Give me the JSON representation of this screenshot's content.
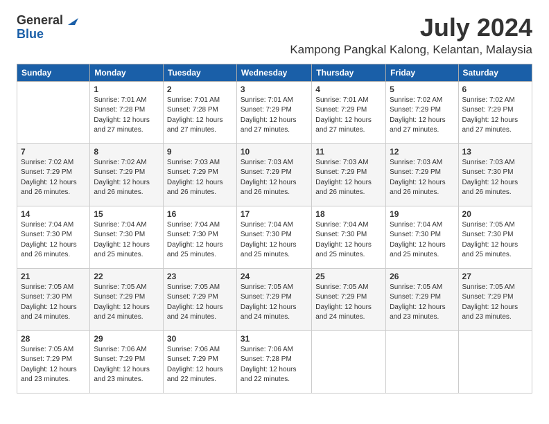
{
  "logo": {
    "general": "General",
    "blue": "Blue"
  },
  "title": "July 2024",
  "subtitle": "Kampong Pangkal Kalong, Kelantan, Malaysia",
  "weekdays": [
    "Sunday",
    "Monday",
    "Tuesday",
    "Wednesday",
    "Thursday",
    "Friday",
    "Saturday"
  ],
  "weeks": [
    [
      {
        "day": "",
        "sunrise": "",
        "sunset": "",
        "daylight": ""
      },
      {
        "day": "1",
        "sunrise": "Sunrise: 7:01 AM",
        "sunset": "Sunset: 7:28 PM",
        "daylight": "Daylight: 12 hours and 27 minutes."
      },
      {
        "day": "2",
        "sunrise": "Sunrise: 7:01 AM",
        "sunset": "Sunset: 7:28 PM",
        "daylight": "Daylight: 12 hours and 27 minutes."
      },
      {
        "day": "3",
        "sunrise": "Sunrise: 7:01 AM",
        "sunset": "Sunset: 7:29 PM",
        "daylight": "Daylight: 12 hours and 27 minutes."
      },
      {
        "day": "4",
        "sunrise": "Sunrise: 7:01 AM",
        "sunset": "Sunset: 7:29 PM",
        "daylight": "Daylight: 12 hours and 27 minutes."
      },
      {
        "day": "5",
        "sunrise": "Sunrise: 7:02 AM",
        "sunset": "Sunset: 7:29 PM",
        "daylight": "Daylight: 12 hours and 27 minutes."
      },
      {
        "day": "6",
        "sunrise": "Sunrise: 7:02 AM",
        "sunset": "Sunset: 7:29 PM",
        "daylight": "Daylight: 12 hours and 27 minutes."
      }
    ],
    [
      {
        "day": "7",
        "sunrise": "Sunrise: 7:02 AM",
        "sunset": "Sunset: 7:29 PM",
        "daylight": "Daylight: 12 hours and 26 minutes."
      },
      {
        "day": "8",
        "sunrise": "Sunrise: 7:02 AM",
        "sunset": "Sunset: 7:29 PM",
        "daylight": "Daylight: 12 hours and 26 minutes."
      },
      {
        "day": "9",
        "sunrise": "Sunrise: 7:03 AM",
        "sunset": "Sunset: 7:29 PM",
        "daylight": "Daylight: 12 hours and 26 minutes."
      },
      {
        "day": "10",
        "sunrise": "Sunrise: 7:03 AM",
        "sunset": "Sunset: 7:29 PM",
        "daylight": "Daylight: 12 hours and 26 minutes."
      },
      {
        "day": "11",
        "sunrise": "Sunrise: 7:03 AM",
        "sunset": "Sunset: 7:29 PM",
        "daylight": "Daylight: 12 hours and 26 minutes."
      },
      {
        "day": "12",
        "sunrise": "Sunrise: 7:03 AM",
        "sunset": "Sunset: 7:29 PM",
        "daylight": "Daylight: 12 hours and 26 minutes."
      },
      {
        "day": "13",
        "sunrise": "Sunrise: 7:03 AM",
        "sunset": "Sunset: 7:30 PM",
        "daylight": "Daylight: 12 hours and 26 minutes."
      }
    ],
    [
      {
        "day": "14",
        "sunrise": "Sunrise: 7:04 AM",
        "sunset": "Sunset: 7:30 PM",
        "daylight": "Daylight: 12 hours and 26 minutes."
      },
      {
        "day": "15",
        "sunrise": "Sunrise: 7:04 AM",
        "sunset": "Sunset: 7:30 PM",
        "daylight": "Daylight: 12 hours and 25 minutes."
      },
      {
        "day": "16",
        "sunrise": "Sunrise: 7:04 AM",
        "sunset": "Sunset: 7:30 PM",
        "daylight": "Daylight: 12 hours and 25 minutes."
      },
      {
        "day": "17",
        "sunrise": "Sunrise: 7:04 AM",
        "sunset": "Sunset: 7:30 PM",
        "daylight": "Daylight: 12 hours and 25 minutes."
      },
      {
        "day": "18",
        "sunrise": "Sunrise: 7:04 AM",
        "sunset": "Sunset: 7:30 PM",
        "daylight": "Daylight: 12 hours and 25 minutes."
      },
      {
        "day": "19",
        "sunrise": "Sunrise: 7:04 AM",
        "sunset": "Sunset: 7:30 PM",
        "daylight": "Daylight: 12 hours and 25 minutes."
      },
      {
        "day": "20",
        "sunrise": "Sunrise: 7:05 AM",
        "sunset": "Sunset: 7:30 PM",
        "daylight": "Daylight: 12 hours and 25 minutes."
      }
    ],
    [
      {
        "day": "21",
        "sunrise": "Sunrise: 7:05 AM",
        "sunset": "Sunset: 7:30 PM",
        "daylight": "Daylight: 12 hours and 24 minutes."
      },
      {
        "day": "22",
        "sunrise": "Sunrise: 7:05 AM",
        "sunset": "Sunset: 7:29 PM",
        "daylight": "Daylight: 12 hours and 24 minutes."
      },
      {
        "day": "23",
        "sunrise": "Sunrise: 7:05 AM",
        "sunset": "Sunset: 7:29 PM",
        "daylight": "Daylight: 12 hours and 24 minutes."
      },
      {
        "day": "24",
        "sunrise": "Sunrise: 7:05 AM",
        "sunset": "Sunset: 7:29 PM",
        "daylight": "Daylight: 12 hours and 24 minutes."
      },
      {
        "day": "25",
        "sunrise": "Sunrise: 7:05 AM",
        "sunset": "Sunset: 7:29 PM",
        "daylight": "Daylight: 12 hours and 24 minutes."
      },
      {
        "day": "26",
        "sunrise": "Sunrise: 7:05 AM",
        "sunset": "Sunset: 7:29 PM",
        "daylight": "Daylight: 12 hours and 23 minutes."
      },
      {
        "day": "27",
        "sunrise": "Sunrise: 7:05 AM",
        "sunset": "Sunset: 7:29 PM",
        "daylight": "Daylight: 12 hours and 23 minutes."
      }
    ],
    [
      {
        "day": "28",
        "sunrise": "Sunrise: 7:05 AM",
        "sunset": "Sunset: 7:29 PM",
        "daylight": "Daylight: 12 hours and 23 minutes."
      },
      {
        "day": "29",
        "sunrise": "Sunrise: 7:06 AM",
        "sunset": "Sunset: 7:29 PM",
        "daylight": "Daylight: 12 hours and 23 minutes."
      },
      {
        "day": "30",
        "sunrise": "Sunrise: 7:06 AM",
        "sunset": "Sunset: 7:29 PM",
        "daylight": "Daylight: 12 hours and 22 minutes."
      },
      {
        "day": "31",
        "sunrise": "Sunrise: 7:06 AM",
        "sunset": "Sunset: 7:28 PM",
        "daylight": "Daylight: 12 hours and 22 minutes."
      },
      {
        "day": "",
        "sunrise": "",
        "sunset": "",
        "daylight": ""
      },
      {
        "day": "",
        "sunrise": "",
        "sunset": "",
        "daylight": ""
      },
      {
        "day": "",
        "sunrise": "",
        "sunset": "",
        "daylight": ""
      }
    ]
  ]
}
